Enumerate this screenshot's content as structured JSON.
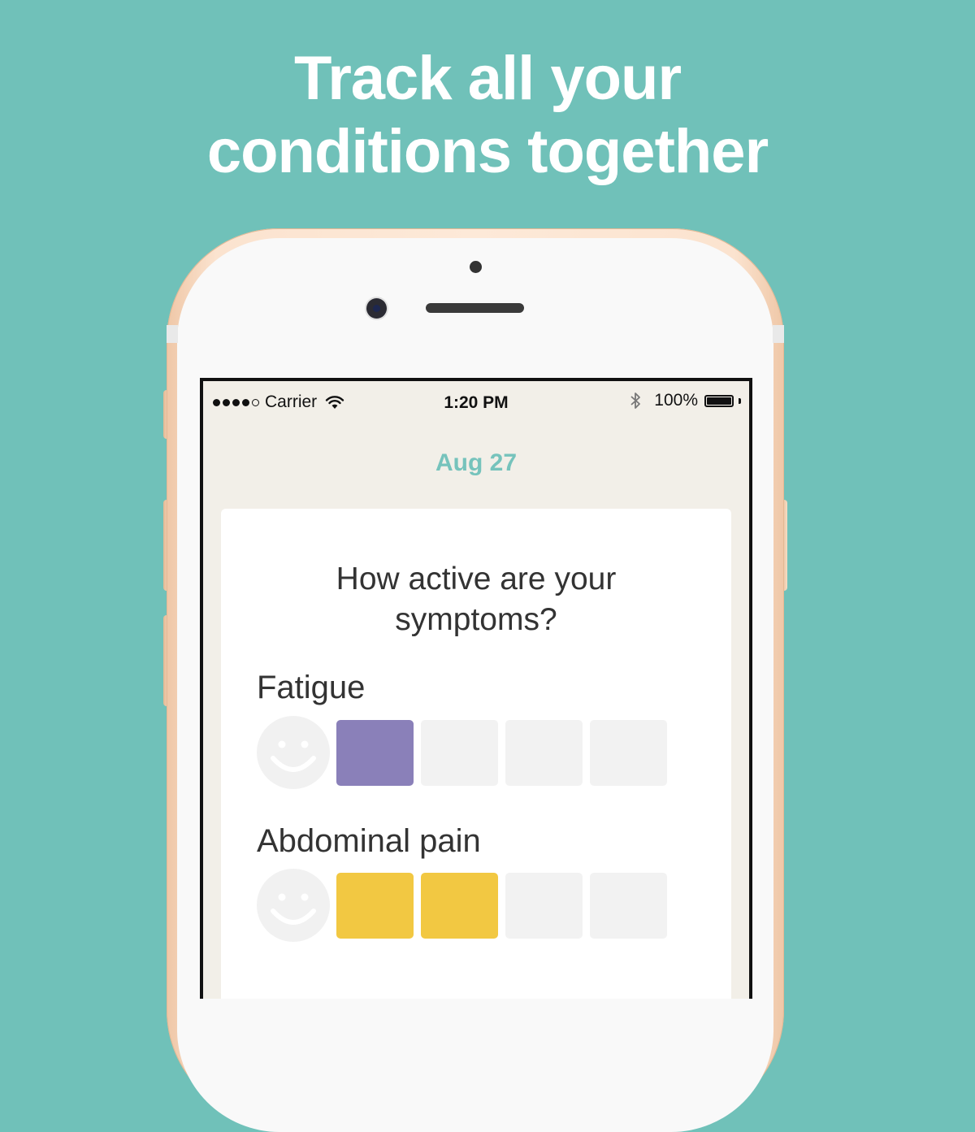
{
  "headline": {
    "line1": "Track all your",
    "line2": "conditions together"
  },
  "status_bar": {
    "carrier": "Carrier",
    "time": "1:20 PM",
    "battery_text": "100%",
    "battery_level": 1.0
  },
  "screen": {
    "date": "Aug 27",
    "question": {
      "line1": "How active are your",
      "line2": "symptoms?"
    },
    "symptoms": [
      {
        "name": "Fatigue",
        "level": 1,
        "max_level": 4,
        "color": "#8a80b9"
      },
      {
        "name": "Abdominal pain",
        "level": 2,
        "max_level": 4,
        "color": "#f2c842"
      }
    ]
  },
  "colors": {
    "background": "#70c1b9",
    "accent": "#76c3bc",
    "empty_level": "#f2f2f2"
  },
  "icons": [
    "wifi-icon",
    "bluetooth-icon",
    "battery-icon",
    "smiley-icon"
  ]
}
